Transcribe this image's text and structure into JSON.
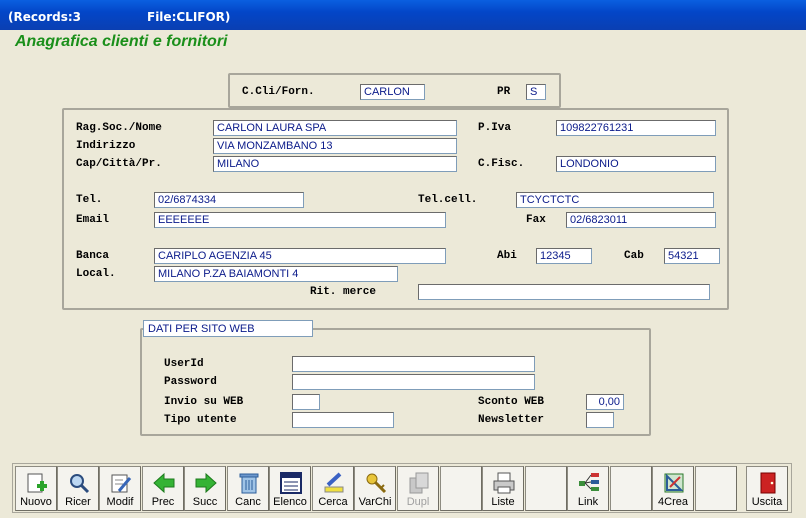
{
  "window": {
    "records": "(Records:3",
    "file": "File:CLIFOR)"
  },
  "form_title": "Anagrafica clienti e fornitori",
  "header": {
    "code_label": "C.Cli/Forn.",
    "code_value": "CARLON",
    "pr_label": "PR",
    "pr_value": "S"
  },
  "main": {
    "ragsoc_label": "Rag.Soc./Nome",
    "ragsoc_value": "CARLON LAURA SPA",
    "indirizzo_label": "Indirizzo",
    "indirizzo_value": "VIA MONZAMBANO 13",
    "cap_label": "Cap/Città/Pr.",
    "cap_value": "MILANO",
    "piva_label": "P.Iva",
    "piva_value": "109822761231",
    "cfisc_label": "C.Fisc.",
    "cfisc_value": "LONDONIO",
    "tel_label": "Tel.",
    "tel_value": "02/6874334",
    "telcell_label": "Tel.cell.",
    "telcell_value": "TCYCTCTC",
    "email_label": "Email",
    "email_value": "EEEEEEE",
    "fax_label": "Fax",
    "fax_value": "02/6823011",
    "banca_label": "Banca",
    "banca_value": "CARIPLO AGENZIA 45",
    "abi_label": "Abi",
    "abi_value": "12345",
    "cab_label": "Cab",
    "cab_value": "54321",
    "local_label": "Local.",
    "local_value": "MILANO P.ZA BAIAMONTI 4",
    "ritmerce_label": "Rit. merce",
    "ritmerce_value": ""
  },
  "web": {
    "title": "DATI PER SITO WEB",
    "userid_label": "UserId",
    "userid_value": "",
    "password_label": "Password",
    "password_value": "",
    "invio_label": "Invio su WEB",
    "invio_value": "",
    "sconto_label": "Sconto WEB",
    "sconto_value": "0,00",
    "tipo_label": "Tipo utente",
    "tipo_value": "",
    "newsletter_label": "Newsletter",
    "newsletter_value": ""
  },
  "toolbar": {
    "nuovo": "Nuovo",
    "ricer": "Ricer",
    "modif": "Modif",
    "prec": "Prec",
    "succ": "Succ",
    "canc": "Canc",
    "elenco": "Elenco",
    "cerca": "Cerca",
    "varchi": "VarChi",
    "dupl": "Dupl",
    "liste": "Liste",
    "link": "Link",
    "crea": "4Crea",
    "uscita": "Uscita"
  },
  "colors": {
    "title_green": "#1a8f1a",
    "field_text": "#0a1a8a",
    "titlebar_blue": "#0346c8"
  }
}
